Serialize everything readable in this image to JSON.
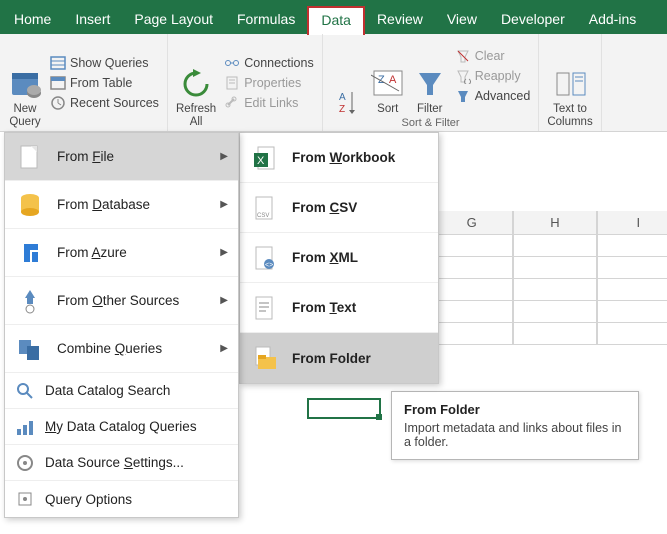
{
  "tabs": {
    "home": "Home",
    "insert": "Insert",
    "page_layout": "Page Layout",
    "formulas": "Formulas",
    "data": "Data",
    "review": "Review",
    "view": "View",
    "developer": "Developer",
    "addins": "Add-ins"
  },
  "ribbon": {
    "new_query": "New\nQuery",
    "show_queries": "Show Queries",
    "from_table": "From Table",
    "recent_sources": "Recent Sources",
    "refresh_all": "Refresh\nAll",
    "connections": "Connections",
    "properties": "Properties",
    "edit_links": "Edit Links",
    "sort_az": "A→Z",
    "sort": "Sort",
    "filter": "Filter",
    "clear": "Clear",
    "reapply": "Reapply",
    "advanced": "Advanced",
    "sort_filter_group": "Sort & Filter",
    "text_to_columns": "Text to\nColumns"
  },
  "menu": {
    "from_file": {
      "pre": "From ",
      "u": "F",
      "post": "ile"
    },
    "from_database": {
      "pre": "From ",
      "u": "D",
      "post": "atabase"
    },
    "from_azure": {
      "pre": "From ",
      "u": "A",
      "post": "zure"
    },
    "from_other": {
      "pre": "From ",
      "u": "O",
      "post": "ther Sources"
    },
    "combine": {
      "pre": "Combine ",
      "u": "Q",
      "post": "ueries"
    },
    "data_catalog_search": "Data Catalog Search",
    "my_data_catalog": {
      "u": "M",
      "post": "y Data Catalog Queries"
    },
    "data_source_settings": {
      "pre": "Data Source ",
      "u": "S",
      "post": "ettings..."
    },
    "query_options": "Query Options"
  },
  "submenu": {
    "from_workbook": {
      "pre": "From ",
      "u": "W",
      "post": "orkbook"
    },
    "from_csv": {
      "pre": "From ",
      "u": "C",
      "post": "SV"
    },
    "from_xml": {
      "pre": "From ",
      "u": "X",
      "post": "ML"
    },
    "from_text": {
      "pre": "From ",
      "u": "T",
      "post": "ext"
    },
    "from_folder": "From Folder"
  },
  "tooltip": {
    "title": "From Folder",
    "body": "Import metadata and links about files in a folder."
  },
  "grid": {
    "cols": [
      "G",
      "H",
      "I"
    ]
  }
}
